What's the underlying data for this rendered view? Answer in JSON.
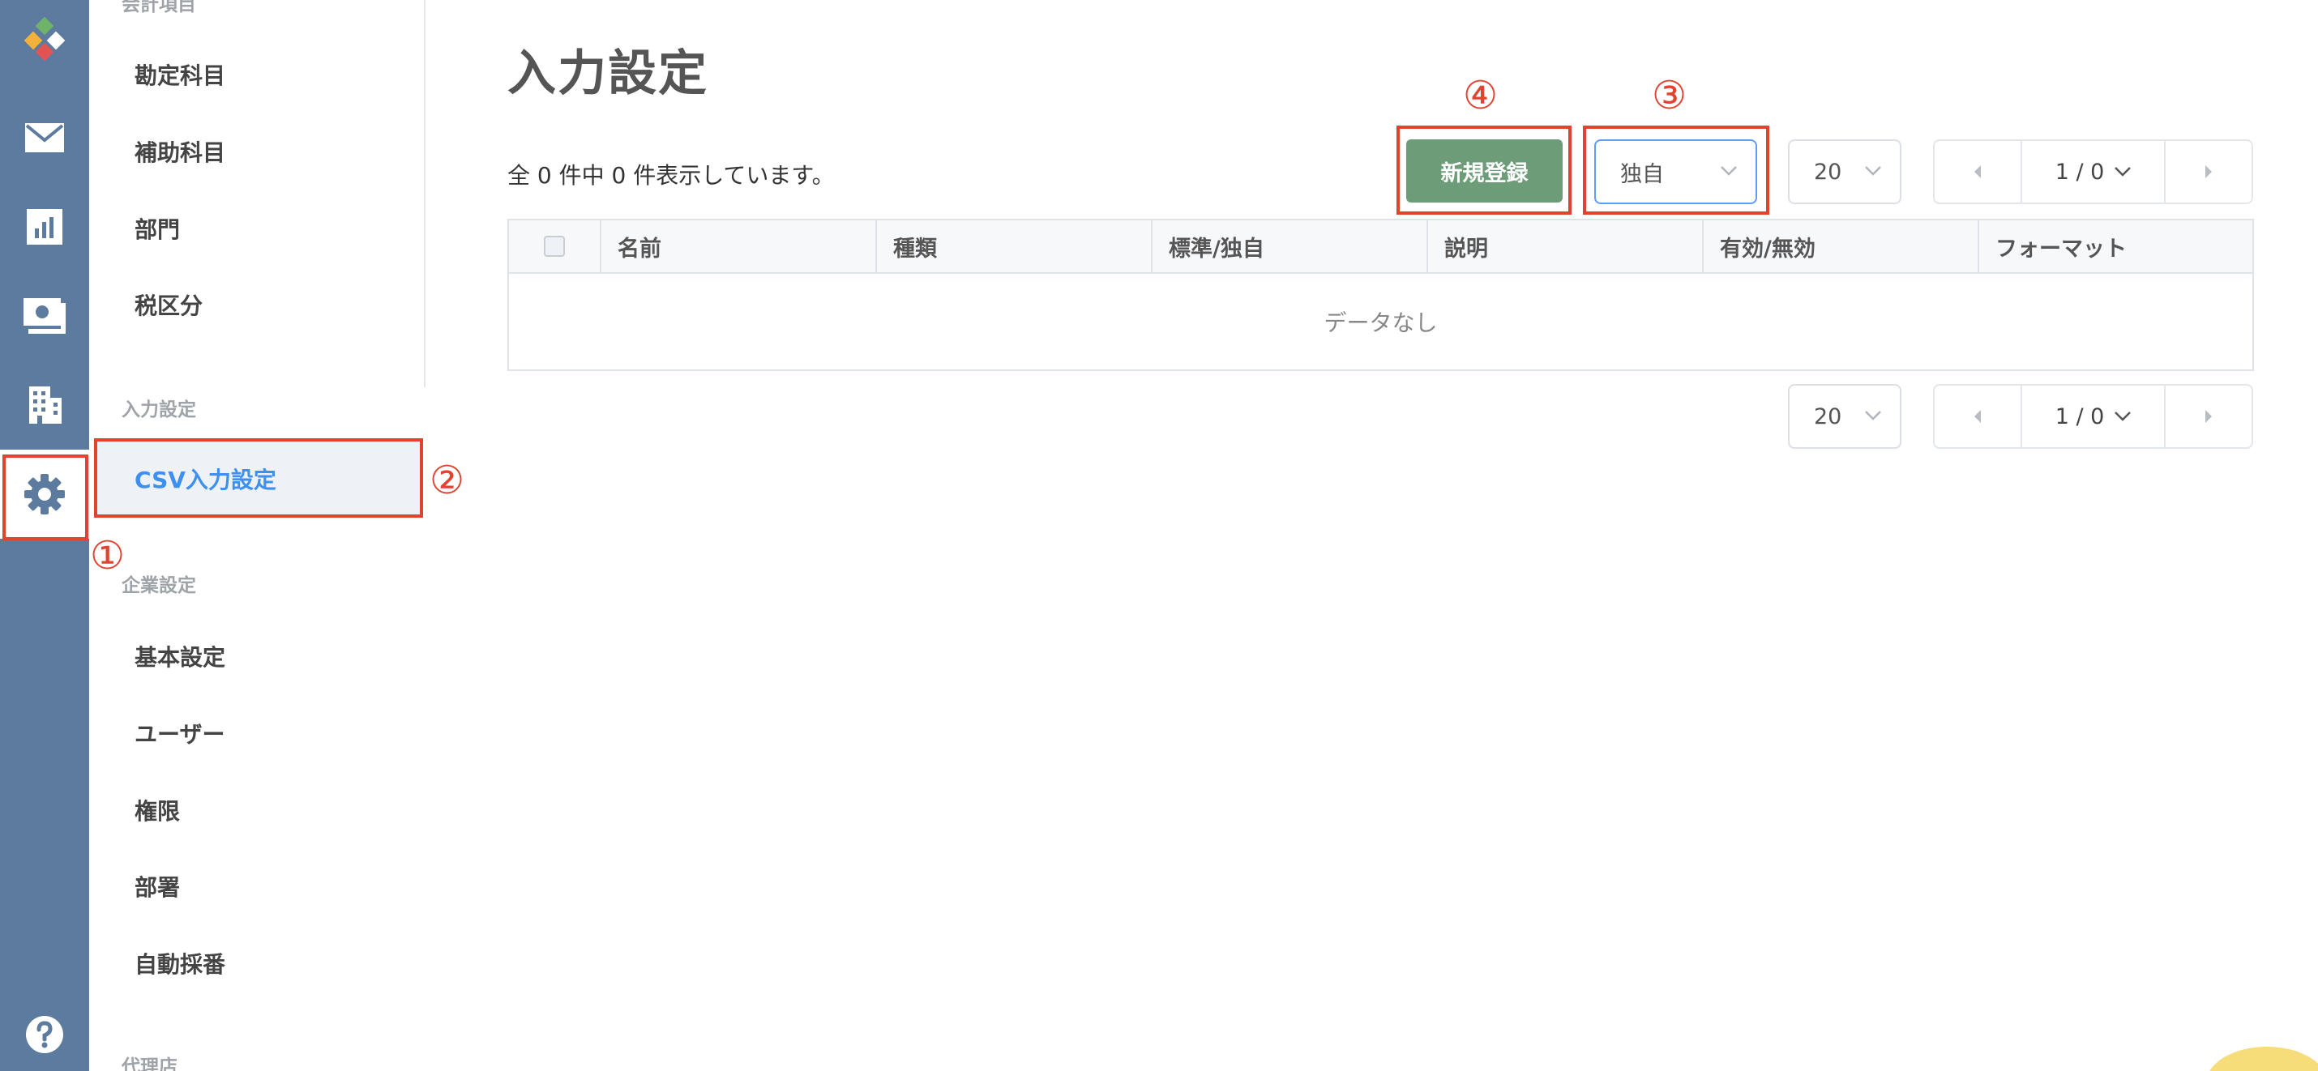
{
  "sidebar": {
    "sections": [
      {
        "label": "会計項目",
        "items": [
          "勘定科目",
          "補助科目",
          "部門",
          "税区分"
        ]
      },
      {
        "label": "入力設定",
        "items": [
          "CSV入力設定"
        ]
      },
      {
        "label": "企業設定",
        "items": [
          "基本設定",
          "ユーザー",
          "権限",
          "部署",
          "自動採番"
        ]
      },
      {
        "label": "代理店",
        "items": []
      }
    ],
    "active_item": "CSV入力設定"
  },
  "rail": {
    "icons": [
      "logo-icon",
      "mail-icon",
      "chart-icon",
      "money-icon",
      "building-icon",
      "gear-icon",
      "help-icon"
    ],
    "active": "gear-icon"
  },
  "main": {
    "title": "入力設定",
    "count_text": "全 0 件中 0 件表示しています。",
    "new_button": "新規登録",
    "type_filter": "独自",
    "page_size": "20",
    "page_indicator": "1 / 0",
    "columns": [
      "名前",
      "種類",
      "標準/独自",
      "説明",
      "有効/無効",
      "フォーマット"
    ],
    "empty_text": "データなし"
  },
  "annotations": [
    "①",
    "②",
    "③",
    "④"
  ],
  "colors": {
    "rail": "#5d7b9e",
    "accent": "#3d8ff0",
    "primary_button": "#6c9c78",
    "annotation": "#e0432f"
  }
}
